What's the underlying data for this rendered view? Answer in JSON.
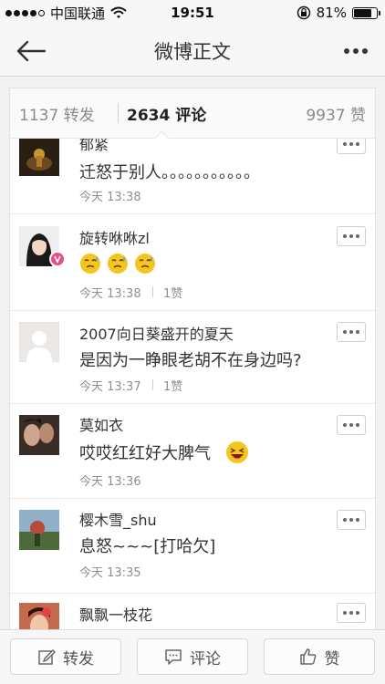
{
  "status_bar": {
    "carrier": "中国联通",
    "time": "19:51",
    "battery_percent_text": "81%",
    "battery_level": 0.81
  },
  "nav": {
    "title": "微博正文"
  },
  "stats": {
    "reposts": "1137 转发",
    "comments": "2634 评论",
    "likes": "9937 赞"
  },
  "comments": [
    {
      "username": "郁紧",
      "text": "迁怒于别人。。。。。。。。。。。",
      "time": "今天 13:38",
      "likes": ""
    },
    {
      "username": "旋转咻咻zl",
      "text": "",
      "time": "今天 13:38",
      "likes": "1赞"
    },
    {
      "username": "2007向日葵盛开的夏天",
      "text": "是因为一睁眼老胡不在身边吗?",
      "time": "今天 13:37",
      "likes": "1赞"
    },
    {
      "username": "莫如衣",
      "text": "哎哎红红好大脾气",
      "time": "今天 13:36",
      "likes": ""
    },
    {
      "username": "樱木雪_shu",
      "text": "息怒~~~[打哈欠]",
      "time": "今天 13:35",
      "likes": ""
    },
    {
      "username": "飘飘一枝花",
      "text": "",
      "time": "",
      "likes": ""
    }
  ],
  "toolbar": {
    "repost": "转发",
    "comment": "评论",
    "like": "赞"
  },
  "colors": {
    "bar_bg": "#f7f7f7",
    "card_bg": "#ffffff",
    "text_primary": "#333333",
    "text_secondary": "#8f8f8f",
    "emoji_yellow": "#f5c51b"
  },
  "icons": [
    "wifi-icon",
    "lock-rotation-icon",
    "battery-icon",
    "back-arrow-icon",
    "more-icon",
    "edit-icon",
    "comment-icon",
    "thumb-up-icon",
    "sweat-emoji-icon",
    "laugh-emoji-icon"
  ]
}
